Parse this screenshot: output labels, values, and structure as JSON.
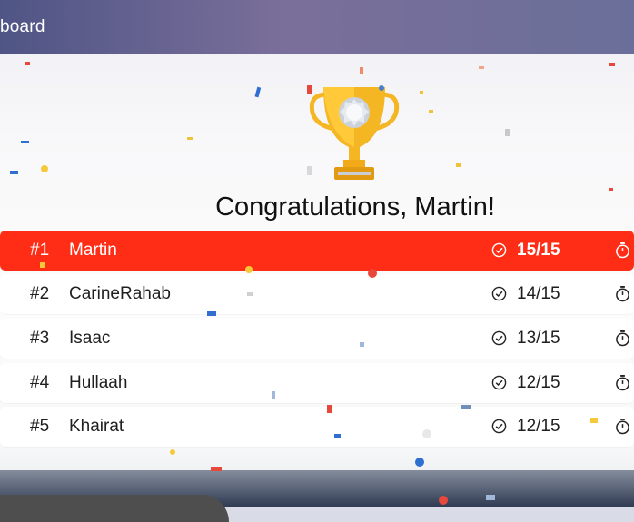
{
  "header": {
    "title": "board"
  },
  "congrats": {
    "text": "Congratulations, Martin!"
  },
  "icons": {
    "trophy": "trophy-icon",
    "check": "check-circle-icon",
    "timer": "stopwatch-icon"
  },
  "colors": {
    "first_row": "#ff2d16",
    "trophy": "#f5b623"
  },
  "leaderboard": [
    {
      "rank": "#1",
      "name": "Martin",
      "score": "15/15"
    },
    {
      "rank": "#2",
      "name": "CarineRahab",
      "score": "14/15"
    },
    {
      "rank": "#3",
      "name": "Isaac",
      "score": "13/15"
    },
    {
      "rank": "#4",
      "name": "Hullaah",
      "score": "12/15"
    },
    {
      "rank": "#5",
      "name": "Khairat",
      "score": "12/15"
    }
  ]
}
